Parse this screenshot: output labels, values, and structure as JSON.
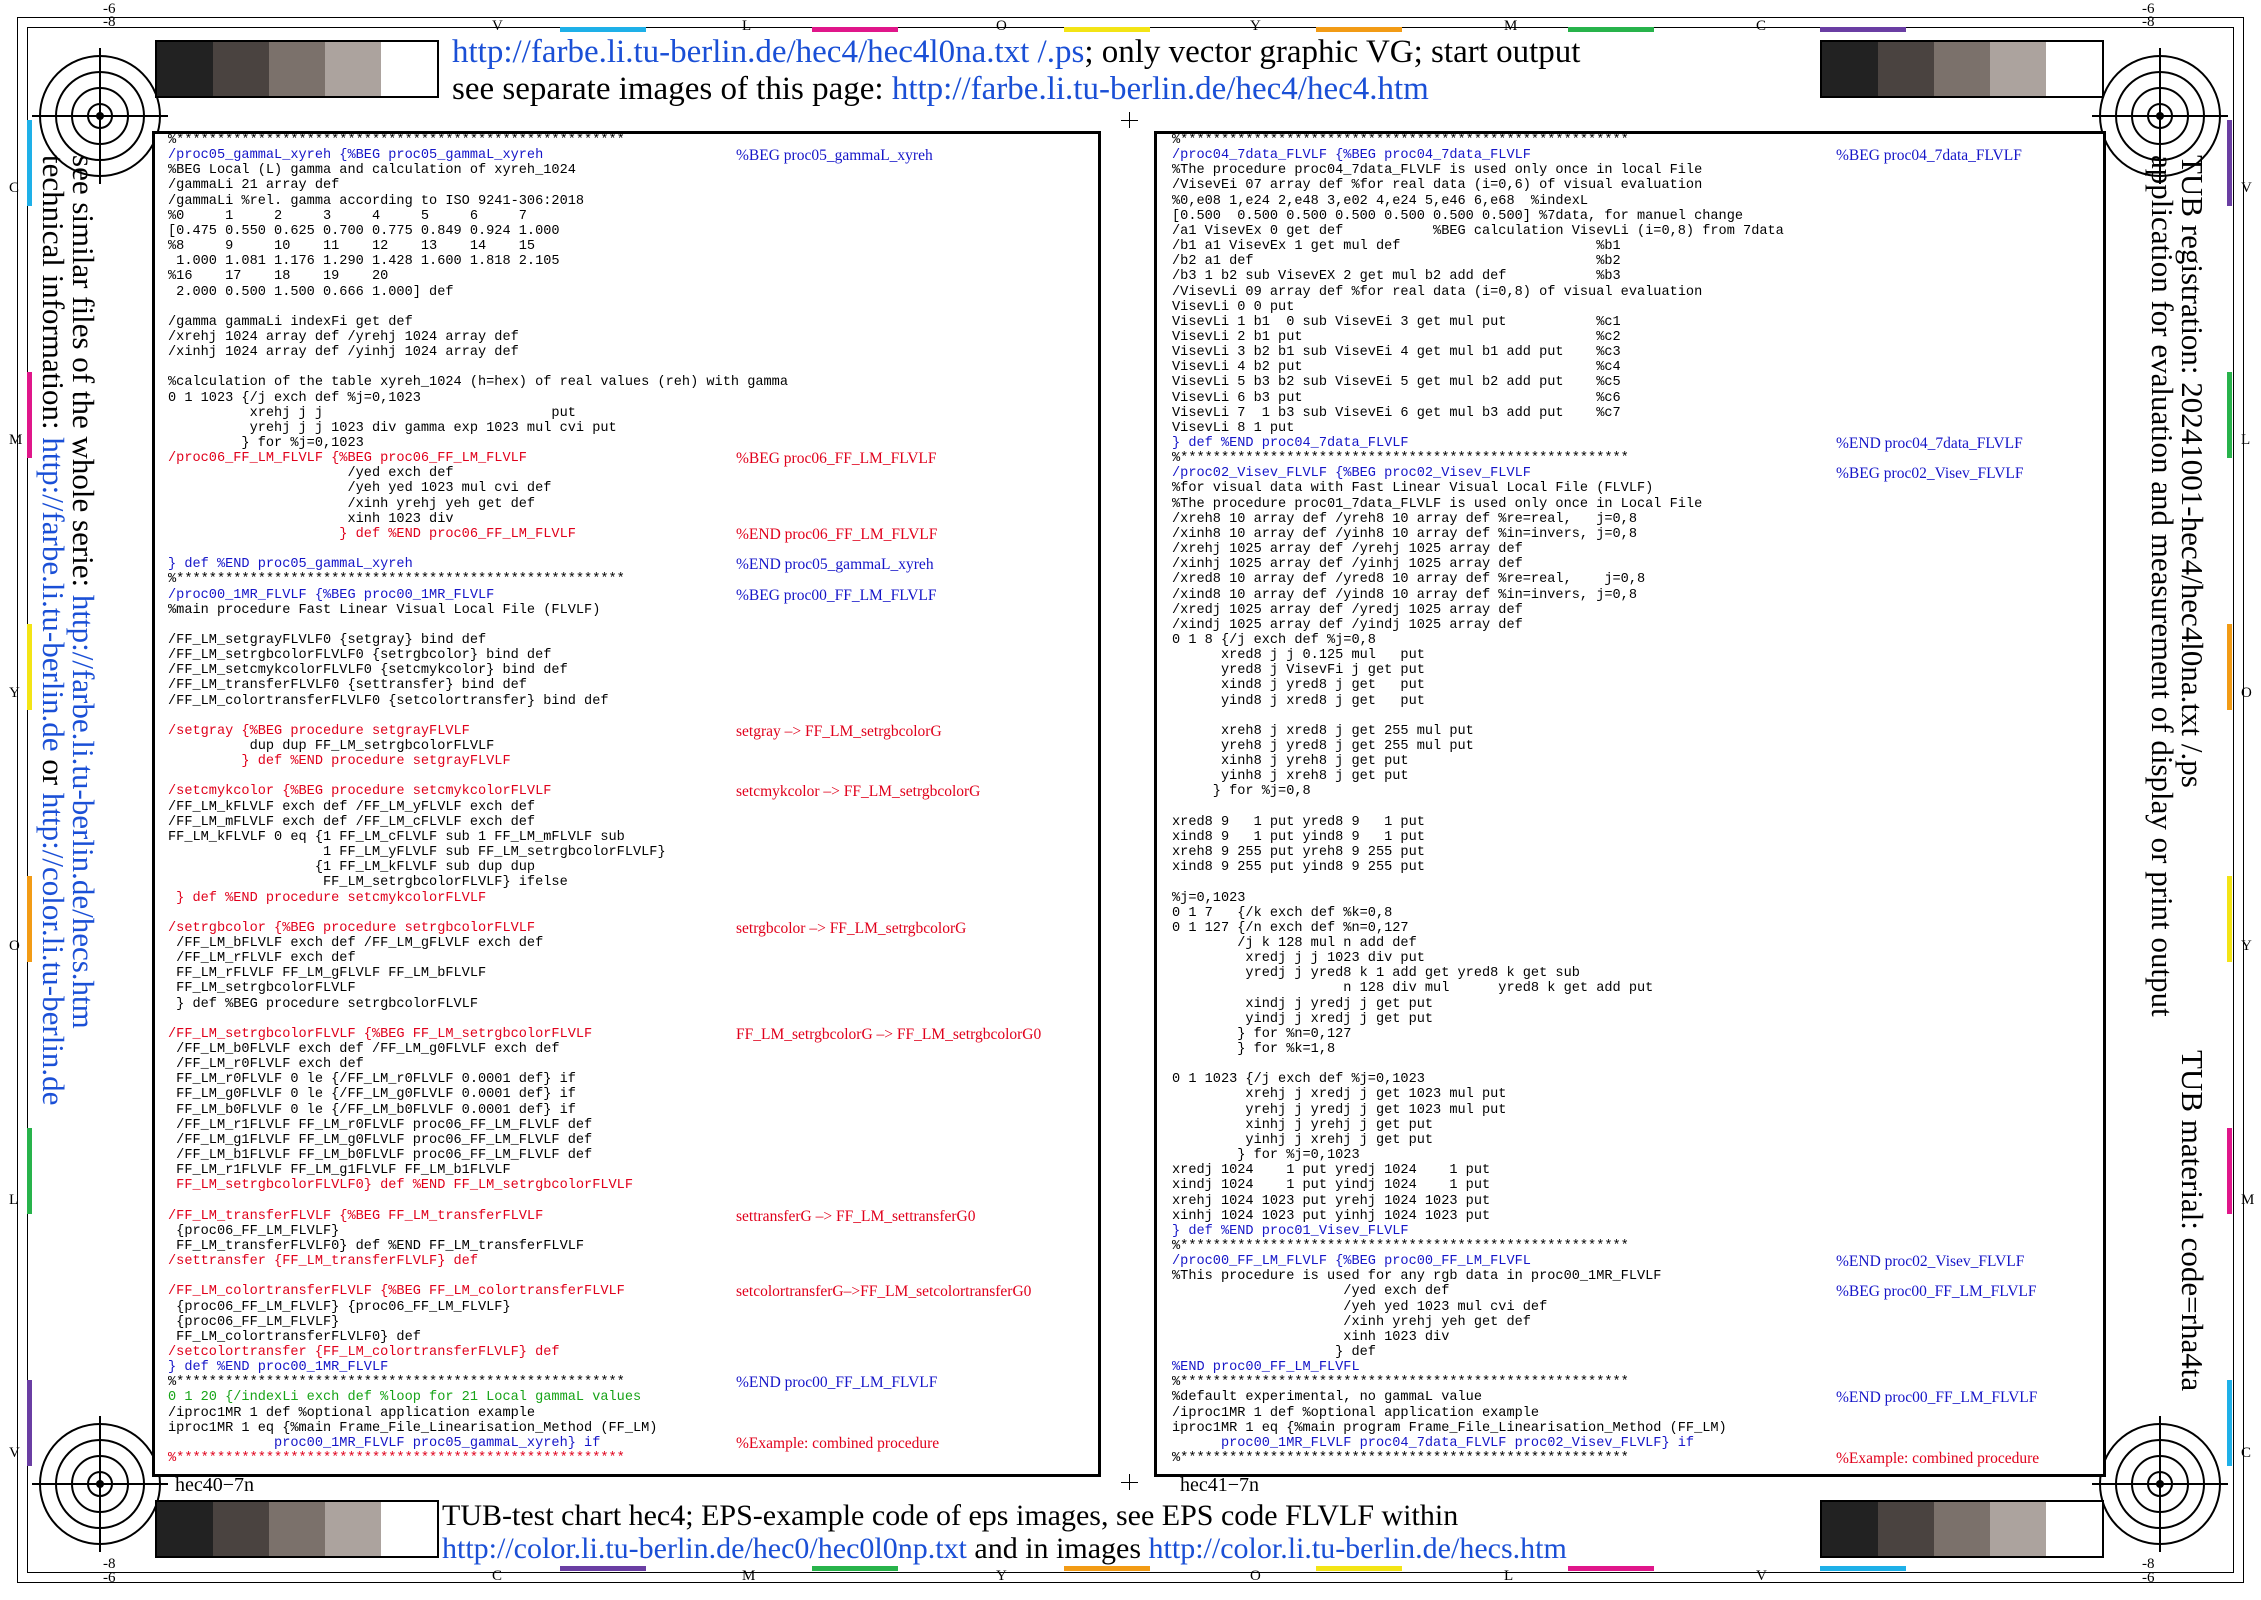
{
  "edge": {
    "corner_top_neg": "-6",
    "corner_inner": "-8",
    "top_letters": [
      "V",
      "L",
      "O",
      "Y",
      "M",
      "C"
    ],
    "bottom_letters": [
      "C",
      "M",
      "Y",
      "O",
      "L",
      "V"
    ],
    "left_letters": [
      "C",
      "M",
      "Y",
      "O",
      "L",
      "V"
    ],
    "right_letters": [
      "V",
      "L",
      "O",
      "Y",
      "M",
      "C"
    ]
  },
  "header": {
    "line1_link": "http://farbe.li.tu-berlin.de/hec4/hec4l0na.txt /.ps",
    "line1_text": "; only vector graphic VG; start output",
    "line2_text": "see separate images of this page: ",
    "line2_link": "http://farbe.li.tu-berlin.de/hec4/hec4.htm"
  },
  "footer": {
    "line1_text": "TUB-test chart hec4; EPS-example code of eps images, see EPS code FLVLF within",
    "line2_link1": "http://color.li.tu-berlin.de/hec0/hec0l0np.txt",
    "line2_mid": " and in images ",
    "line2_link2": "http://color.li.tu-berlin.de/hecs.htm"
  },
  "left_side": {
    "line1_text": "see similar files of the whole serie: ",
    "line1_link": "http://farbe.li.tu-berlin.de/hecs.htm",
    "line2_text": "technical information: ",
    "line2_link1": "http://farbe.li.tu-berlin.de",
    "line2_mid": " or ",
    "line2_link2": "http://color.li.tu-berlin.de"
  },
  "right_side": {
    "line1": "TUB registration: 20241001-hec4/hec4l0na.txt /.ps",
    "line2": "application for evaluation and measurement of display or print output",
    "material": "TUB material: code=rha4ta"
  },
  "panels": {
    "left_id": "hec40−7n",
    "right_id": "hec41−7n"
  },
  "left_code": [
    {
      "c": "k",
      "t": "%*******************************************************"
    },
    {
      "c": "b",
      "t": "/proc05_gammaL_xyreh {%BEG proc05_gammaL_xyreh"
    },
    {
      "c": "k",
      "t": "%BEG Local (L) gamma and calculation of xyreh_1024"
    },
    {
      "c": "k",
      "t": "/gammaLi 21 array def"
    },
    {
      "c": "k",
      "t": "/gammaLi %rel. gamma according to ISO 9241-306:2018"
    },
    {
      "c": "k",
      "t": "%0     1     2     3     4     5     6     7"
    },
    {
      "c": "k",
      "t": "[0.475 0.550 0.625 0.700 0.775 0.849 0.924 1.000"
    },
    {
      "c": "k",
      "t": "%8     9     10    11    12    13    14    15"
    },
    {
      "c": "k",
      "t": " 1.000 1.081 1.176 1.290 1.428 1.600 1.818 2.105"
    },
    {
      "c": "k",
      "t": "%16    17    18    19    20"
    },
    {
      "c": "k",
      "t": " 2.000 0.500 1.500 0.666 1.000] def"
    },
    {
      "c": "k",
      "t": ""
    },
    {
      "c": "k",
      "t": "/gamma gammaLi indexFi get def"
    },
    {
      "c": "k",
      "t": "/xrehj 1024 array def /yrehj 1024 array def"
    },
    {
      "c": "k",
      "t": "/xinhj 1024 array def /yinhj 1024 array def"
    },
    {
      "c": "k",
      "t": ""
    },
    {
      "c": "k",
      "t": "%calculation of the table xyreh_1024 (h=hex) of real values (reh) with gamma"
    },
    {
      "c": "k",
      "t": "0 1 1023 {/j exch def %j=0,1023"
    },
    {
      "c": "k",
      "t": "          xrehj j j                            put"
    },
    {
      "c": "k",
      "t": "          yrehj j j 1023 div gamma exp 1023 mul cvi put"
    },
    {
      "c": "k",
      "t": "         } for %j=0,1023"
    },
    {
      "c": "r",
      "t": "/proc06_FF_LM_FLVLF {%BEG proc06_FF_LM_FLVLF"
    },
    {
      "c": "k",
      "t": "                      /yed exch def"
    },
    {
      "c": "k",
      "t": "                      /yeh yed 1023 mul cvi def"
    },
    {
      "c": "k",
      "t": "                      /xinh yrehj yeh get def"
    },
    {
      "c": "k",
      "t": "                      xinh 1023 div"
    },
    {
      "c": "r",
      "t": "                     } def %END proc06_FF_LM_FLVLF"
    },
    {
      "c": "k",
      "t": ""
    },
    {
      "c": "b",
      "t": "} def %END proc05_gammaL_xyreh"
    },
    {
      "c": "k",
      "t": "%*******************************************************"
    },
    {
      "c": "b",
      "t": "/proc00_1MR_FLVLF {%BEG proc00_1MR_FLVLF"
    },
    {
      "c": "k",
      "t": "%main procedure Fast Linear Visual Local File (FLVLF)"
    },
    {
      "c": "k",
      "t": ""
    },
    {
      "c": "k",
      "t": "/FF_LM_setgrayFLVLF0 {setgray} bind def"
    },
    {
      "c": "k",
      "t": "/FF_LM_setrgbcolorFLVLF0 {setrgbcolor} bind def"
    },
    {
      "c": "k",
      "t": "/FF_LM_setcmykcolorFLVLF0 {setcmykcolor} bind def"
    },
    {
      "c": "k",
      "t": "/FF_LM_transferFLVLF0 {settransfer} bind def"
    },
    {
      "c": "k",
      "t": "/FF_LM_colortransferFLVLF0 {setcolortransfer} bind def"
    },
    {
      "c": "k",
      "t": ""
    },
    {
      "c": "r",
      "t": "/setgray {%BEG procedure setgrayFLVLF"
    },
    {
      "c": "k",
      "t": "          dup dup FF_LM_setrgbcolorFLVLF"
    },
    {
      "c": "r",
      "t": "         } def %END procedure setgrayFLVLF"
    },
    {
      "c": "k",
      "t": ""
    },
    {
      "c": "r",
      "t": "/setcmykcolor {%BEG procedure setcmykcolorFLVLF"
    },
    {
      "c": "k",
      "t": "/FF_LM_kFLVLF exch def /FF_LM_yFLVLF exch def"
    },
    {
      "c": "k",
      "t": "/FF_LM_mFLVLF exch def /FF_LM_cFLVLF exch def"
    },
    {
      "c": "k",
      "t": "FF_LM_kFLVLF 0 eq {1 FF_LM_cFLVLF sub 1 FF_LM_mFLVLF sub"
    },
    {
      "c": "k",
      "t": "                   1 FF_LM_yFLVLF sub FF_LM_setrgbcolorFLVLF}"
    },
    {
      "c": "k",
      "t": "                  {1 FF_LM_kFLVLF sub dup dup"
    },
    {
      "c": "k",
      "t": "                   FF_LM_setrgbcolorFLVLF} ifelse"
    },
    {
      "c": "r",
      "t": " } def %END procedure setcmykcolorFLVLF"
    },
    {
      "c": "k",
      "t": ""
    },
    {
      "c": "r",
      "t": "/setrgbcolor {%BEG procedure setrgbcolorFLVLF"
    },
    {
      "c": "k",
      "t": " /FF_LM_bFLVLF exch def /FF_LM_gFLVLF exch def"
    },
    {
      "c": "k",
      "t": " /FF_LM_rFLVLF exch def"
    },
    {
      "c": "k",
      "t": " FF_LM_rFLVLF FF_LM_gFLVLF FF_LM_bFLVLF"
    },
    {
      "c": "k",
      "t": " FF_LM_setrgbcolorFLVLF"
    },
    {
      "c": "k",
      "t": " } def %BEG procedure setrgbcolorFLVLF"
    },
    {
      "c": "k",
      "t": ""
    },
    {
      "c": "r",
      "t": "/FF_LM_setrgbcolorFLVLF {%BEG FF_LM_setrgbcolorFLVLF"
    },
    {
      "c": "k",
      "t": " /FF_LM_b0FLVLF exch def /FF_LM_g0FLVLF exch def"
    },
    {
      "c": "k",
      "t": " /FF_LM_r0FLVLF exch def"
    },
    {
      "c": "k",
      "t": " FF_LM_r0FLVLF 0 le {/FF_LM_r0FLVLF 0.0001 def} if"
    },
    {
      "c": "k",
      "t": " FF_LM_g0FLVLF 0 le {/FF_LM_g0FLVLF 0.0001 def} if"
    },
    {
      "c": "k",
      "t": " FF_LM_b0FLVLF 0 le {/FF_LM_b0FLVLF 0.0001 def} if"
    },
    {
      "c": "k",
      "t": " /FF_LM_r1FLVLF FF_LM_r0FLVLF proc06_FF_LM_FLVLF def"
    },
    {
      "c": "k",
      "t": " /FF_LM_g1FLVLF FF_LM_g0FLVLF proc06_FF_LM_FLVLF def"
    },
    {
      "c": "k",
      "t": " /FF_LM_b1FLVLF FF_LM_b0FLVLF proc06_FF_LM_FLVLF def"
    },
    {
      "c": "k",
      "t": " FF_LM_r1FLVLF FF_LM_g1FLVLF FF_LM_b1FLVLF"
    },
    {
      "c": "r",
      "t": " FF_LM_setrgbcolorFLVLF0} def %END FF_LM_setrgbcolorFLVLF"
    },
    {
      "c": "k",
      "t": ""
    },
    {
      "c": "r",
      "t": "/FF_LM_transferFLVLF {%BEG FF_LM_transferFLVLF"
    },
    {
      "c": "k",
      "t": " {proc06_FF_LM_FLVLF}"
    },
    {
      "c": "k",
      "t": " FF_LM_transferFLVLF0} def %END FF_LM_transferFLVLF"
    },
    {
      "c": "r",
      "t": "/settransfer {FF_LM_transferFLVLF} def"
    },
    {
      "c": "k",
      "t": ""
    },
    {
      "c": "r",
      "t": "/FF_LM_colortransferFLVLF {%BEG FF_LM_colortransferFLVLF"
    },
    {
      "c": "k",
      "t": " {proc06_FF_LM_FLVLF} {proc06_FF_LM_FLVLF}"
    },
    {
      "c": "k",
      "t": " {proc06_FF_LM_FLVLF}"
    },
    {
      "c": "k",
      "t": " FF_LM_colortransferFLVLF0} def"
    },
    {
      "c": "r",
      "t": "/setcolortransfer {FF_LM_colortransferFLVLF} def"
    },
    {
      "c": "b",
      "t": "} def %END proc00_1MR_FLVLF"
    },
    {
      "c": "k",
      "t": "%*******************************************************"
    },
    {
      "c": "g",
      "t": "0 1 20 {/indexLi exch def %loop for 21 Local gammaL values"
    },
    {
      "c": "k",
      "t": "/iproc1MR 1 def %optional application example"
    },
    {
      "c": "k",
      "t": "iproc1MR 1 eq {%main Frame_File_Linearisation_Method (FF_LM)"
    },
    {
      "c": "b",
      "t": "             proc00_1MR_FLVLF proc05_gammaL_xyreh} if"
    },
    {
      "c": "r",
      "t": "%*******************************************************"
    }
  ],
  "left_notes": [
    {
      "row": 1,
      "c": "b",
      "t": "%BEG proc05_gammaL_xyreh"
    },
    {
      "row": 21,
      "c": "r",
      "t": "%BEG proc06_FF_LM_FLVLF"
    },
    {
      "row": 26,
      "c": "r",
      "t": "%END proc06_FF_LM_FLVLF"
    },
    {
      "row": 28,
      "c": "b",
      "t": "%END proc05_gammaL_xyreh"
    },
    {
      "row": 30,
      "c": "b",
      "t": "%BEG proc00_FF_LM_FLVLF"
    },
    {
      "row": 39,
      "c": "r",
      "t": "setgray –> FF_LM_setrgbcolorG"
    },
    {
      "row": 43,
      "c": "r",
      "t": "setcmykcolor –> FF_LM_setrgbcolorG"
    },
    {
      "row": 52,
      "c": "r",
      "t": "setrgbcolor –> FF_LM_setrgbcolorG"
    },
    {
      "row": 59,
      "c": "r",
      "t": "FF_LM_setrgbcolorG –> FF_LM_setrgbcolorG0"
    },
    {
      "row": 71,
      "c": "r",
      "t": "settransferG –> FF_LM_settransferG0"
    },
    {
      "row": 76,
      "c": "r",
      "t": "setcolortransferG–>FF_LM_setcolortransferG0"
    },
    {
      "row": 82,
      "c": "b",
      "t": "%END proc00_FF_LM_FLVLF"
    },
    {
      "row": 86,
      "c": "r",
      "t": "%Example: combined procedure"
    }
  ],
  "right_code": [
    {
      "c": "k",
      "t": "%*******************************************************"
    },
    {
      "c": "b",
      "t": "/proc04_7data_FLVLF {%BEG proc04_7data_FLVLF"
    },
    {
      "c": "k",
      "t": "%The procedure proc04_7data_FLVLF is used only once in local File"
    },
    {
      "c": "k",
      "t": "/VisevEi 07 array def %for real data (i=0,6) of visual evaluation"
    },
    {
      "c": "k",
      "t": "%0,e08 1,e24 2,e48 3,e02 4,e24 5,e46 6,e68  %indexL"
    },
    {
      "c": "k",
      "t": "[0.500  0.500 0.500 0.500 0.500 0.500 0.500] %7data, for manuel change"
    },
    {
      "c": "k",
      "t": "/a1 VisevEx 0 get def           %BEG calculation VisevLi (i=0,8) from 7data"
    },
    {
      "c": "k",
      "t": "/b1 a1 VisevEx 1 get mul def                        %b1"
    },
    {
      "c": "k",
      "t": "/b2 a1 def                                          %b2"
    },
    {
      "c": "k",
      "t": "/b3 1 b2 sub VisevEX 2 get mul b2 add def           %b3"
    },
    {
      "c": "k",
      "t": "/VisevLi 09 array def %for real data (i=0,8) of visual evaluation"
    },
    {
      "c": "k",
      "t": "VisevLi 0 0 put"
    },
    {
      "c": "k",
      "t": "VisevLi 1 b1  0 sub VisevEi 3 get mul put           %c1"
    },
    {
      "c": "k",
      "t": "VisevLi 2 b1 put                                    %c2"
    },
    {
      "c": "k",
      "t": "VisevLi 3 b2 b1 sub VisevEi 4 get mul b1 add put    %c3"
    },
    {
      "c": "k",
      "t": "VisevLi 4 b2 put                                    %c4"
    },
    {
      "c": "k",
      "t": "VisevLi 5 b3 b2 sub VisevEi 5 get mul b2 add put    %c5"
    },
    {
      "c": "k",
      "t": "VisevLi 6 b3 put                                    %c6"
    },
    {
      "c": "k",
      "t": "VisevLi 7  1 b3 sub VisevEi 6 get mul b3 add put    %c7"
    },
    {
      "c": "k",
      "t": "VisevLi 8 1 put"
    },
    {
      "c": "b",
      "t": "} def %END proc04_7data_FLVLF"
    },
    {
      "c": "k",
      "t": "%*******************************************************"
    },
    {
      "c": "b",
      "t": "/proc02_Visev_FLVLF {%BEG proc02_Visev_FLVLF"
    },
    {
      "c": "k",
      "t": "%for visual data with Fast Linear Visual Local File (FLVLF)"
    },
    {
      "c": "k",
      "t": "%The procedure proc01_7data_FLVLF is used only once in Local File"
    },
    {
      "c": "k",
      "t": "/xreh8 10 array def /yreh8 10 array def %re=real,   j=0,8"
    },
    {
      "c": "k",
      "t": "/xinh8 10 array def /yinh8 10 array def %in=invers, j=0,8"
    },
    {
      "c": "k",
      "t": "/xrehj 1025 array def /yrehj 1025 array def"
    },
    {
      "c": "k",
      "t": "/xinhj 1025 array def /yinhj 1025 array def"
    },
    {
      "c": "k",
      "t": "/xred8 10 array def /yred8 10 array def %re=real,    j=0,8"
    },
    {
      "c": "k",
      "t": "/xind8 10 array def /yind8 10 array def %in=invers, j=0,8"
    },
    {
      "c": "k",
      "t": "/xredj 1025 array def /yredj 1025 array def"
    },
    {
      "c": "k",
      "t": "/xindj 1025 array def /yindj 1025 array def"
    },
    {
      "c": "k",
      "t": "0 1 8 {/j exch def %j=0,8"
    },
    {
      "c": "k",
      "t": "      xred8 j j 0.125 mul   put"
    },
    {
      "c": "k",
      "t": "      yred8 j VisevFi j get put"
    },
    {
      "c": "k",
      "t": "      xind8 j yred8 j get   put"
    },
    {
      "c": "k",
      "t": "      yind8 j xred8 j get   put"
    },
    {
      "c": "k",
      "t": ""
    },
    {
      "c": "k",
      "t": "      xreh8 j xred8 j get 255 mul put"
    },
    {
      "c": "k",
      "t": "      yreh8 j yred8 j get 255 mul put"
    },
    {
      "c": "k",
      "t": "      xinh8 j yreh8 j get put"
    },
    {
      "c": "k",
      "t": "      yinh8 j xreh8 j get put"
    },
    {
      "c": "k",
      "t": "     } for %j=0,8"
    },
    {
      "c": "k",
      "t": ""
    },
    {
      "c": "k",
      "t": "xred8 9   1 put yred8 9   1 put"
    },
    {
      "c": "k",
      "t": "xind8 9   1 put yind8 9   1 put"
    },
    {
      "c": "k",
      "t": "xreh8 9 255 put yreh8 9 255 put"
    },
    {
      "c": "k",
      "t": "xind8 9 255 put yind8 9 255 put"
    },
    {
      "c": "k",
      "t": ""
    },
    {
      "c": "k",
      "t": "%j=0,1023"
    },
    {
      "c": "k",
      "t": "0 1 7   {/k exch def %k=0,8"
    },
    {
      "c": "k",
      "t": "0 1 127 {/n exch def %n=0,127"
    },
    {
      "c": "k",
      "t": "        /j k 128 mul n add def"
    },
    {
      "c": "k",
      "t": "         xredj j j 1023 div put"
    },
    {
      "c": "k",
      "t": "         yredj j yred8 k 1 add get yred8 k get sub"
    },
    {
      "c": "k",
      "t": "                     n 128 div mul      yred8 k get add put"
    },
    {
      "c": "k",
      "t": "         xindj j yredj j get put"
    },
    {
      "c": "k",
      "t": "         yindj j xredj j get put"
    },
    {
      "c": "k",
      "t": "        } for %n=0,127"
    },
    {
      "c": "k",
      "t": "        } for %k=1,8"
    },
    {
      "c": "k",
      "t": ""
    },
    {
      "c": "k",
      "t": "0 1 1023 {/j exch def %j=0,1023"
    },
    {
      "c": "k",
      "t": "         xrehj j xredj j get 1023 mul put"
    },
    {
      "c": "k",
      "t": "         yrehj j yredj j get 1023 mul put"
    },
    {
      "c": "k",
      "t": "         xinhj j yrehj j get put"
    },
    {
      "c": "k",
      "t": "         yinhj j xrehj j get put"
    },
    {
      "c": "k",
      "t": "        } for %j=0,1023"
    },
    {
      "c": "k",
      "t": "xredj 1024    1 put yredj 1024    1 put"
    },
    {
      "c": "k",
      "t": "xindj 1024    1 put yindj 1024    1 put"
    },
    {
      "c": "k",
      "t": "xrehj 1024 1023 put yrehj 1024 1023 put"
    },
    {
      "c": "k",
      "t": "xinhj 1024 1023 put yinhj 1024 1023 put"
    },
    {
      "c": "b",
      "t": "} def %END proc01_Visev_FLVLF"
    },
    {
      "c": "k",
      "t": "%*******************************************************"
    },
    {
      "c": "b",
      "t": "/proc00_FF_LM_FLVLF {%BEG proc00_FF_LM_FLVFL"
    },
    {
      "c": "k",
      "t": "%This procedure is used for any rgb data in proc00_1MR_FLVLF"
    },
    {
      "c": "k",
      "t": "                     /yed exch def"
    },
    {
      "c": "k",
      "t": "                     /yeh yed 1023 mul cvi def"
    },
    {
      "c": "k",
      "t": "                     /xinh yrehj yeh get def"
    },
    {
      "c": "k",
      "t": "                     xinh 1023 div"
    },
    {
      "c": "k",
      "t": "                    } def"
    },
    {
      "c": "b",
      "t": "%END proc00_FF_LM_FLVFL"
    },
    {
      "c": "k",
      "t": "%*******************************************************"
    },
    {
      "c": "k",
      "t": "%default experimental, no gammaL value"
    },
    {
      "c": "k",
      "t": "/iproc1MR 1 def %optional application example"
    },
    {
      "c": "k",
      "t": "iproc1MR 1 eq {%main program Frame_File_Linearisation_Method (FF_LM)"
    },
    {
      "c": "b",
      "t": "      proc00_1MR_FLVLF proc04_7data_FLVLF proc02_Visev_FLVLF} if"
    },
    {
      "c": "k",
      "t": "%*******************************************************"
    }
  ],
  "right_notes": [
    {
      "row": 1,
      "c": "b",
      "t": "%BEG proc04_7data_FLVLF"
    },
    {
      "row": 20,
      "c": "b",
      "t": "%END proc04_7data_FLVLF"
    },
    {
      "row": 22,
      "c": "b",
      "t": "%BEG proc02_Visev_FLVLF"
    },
    {
      "row": 74,
      "c": "b",
      "t": "%END proc02_Visev_FLVLF"
    },
    {
      "row": 76,
      "c": "b",
      "t": "%BEG proc00_FF_LM_FLVLF"
    },
    {
      "row": 83,
      "c": "b",
      "t": "%END proc00_FF_LM_FLVLF"
    },
    {
      "row": 87,
      "c": "r",
      "t": "%Example: combined procedure"
    }
  ],
  "colors": {
    "link": "#1a4fd6",
    "code_blue": "#1515c8",
    "code_red": "#e0001b",
    "code_green": "#17a317",
    "gray_steps": [
      "#222222",
      "#4a4340",
      "#7b716b",
      "#aca39e",
      "#ffffff"
    ],
    "tick_colors": [
      "#1eb0e8",
      "#e0168a",
      "#f3e415",
      "#f29b15",
      "#28b34b",
      "#6a3ea3"
    ]
  }
}
